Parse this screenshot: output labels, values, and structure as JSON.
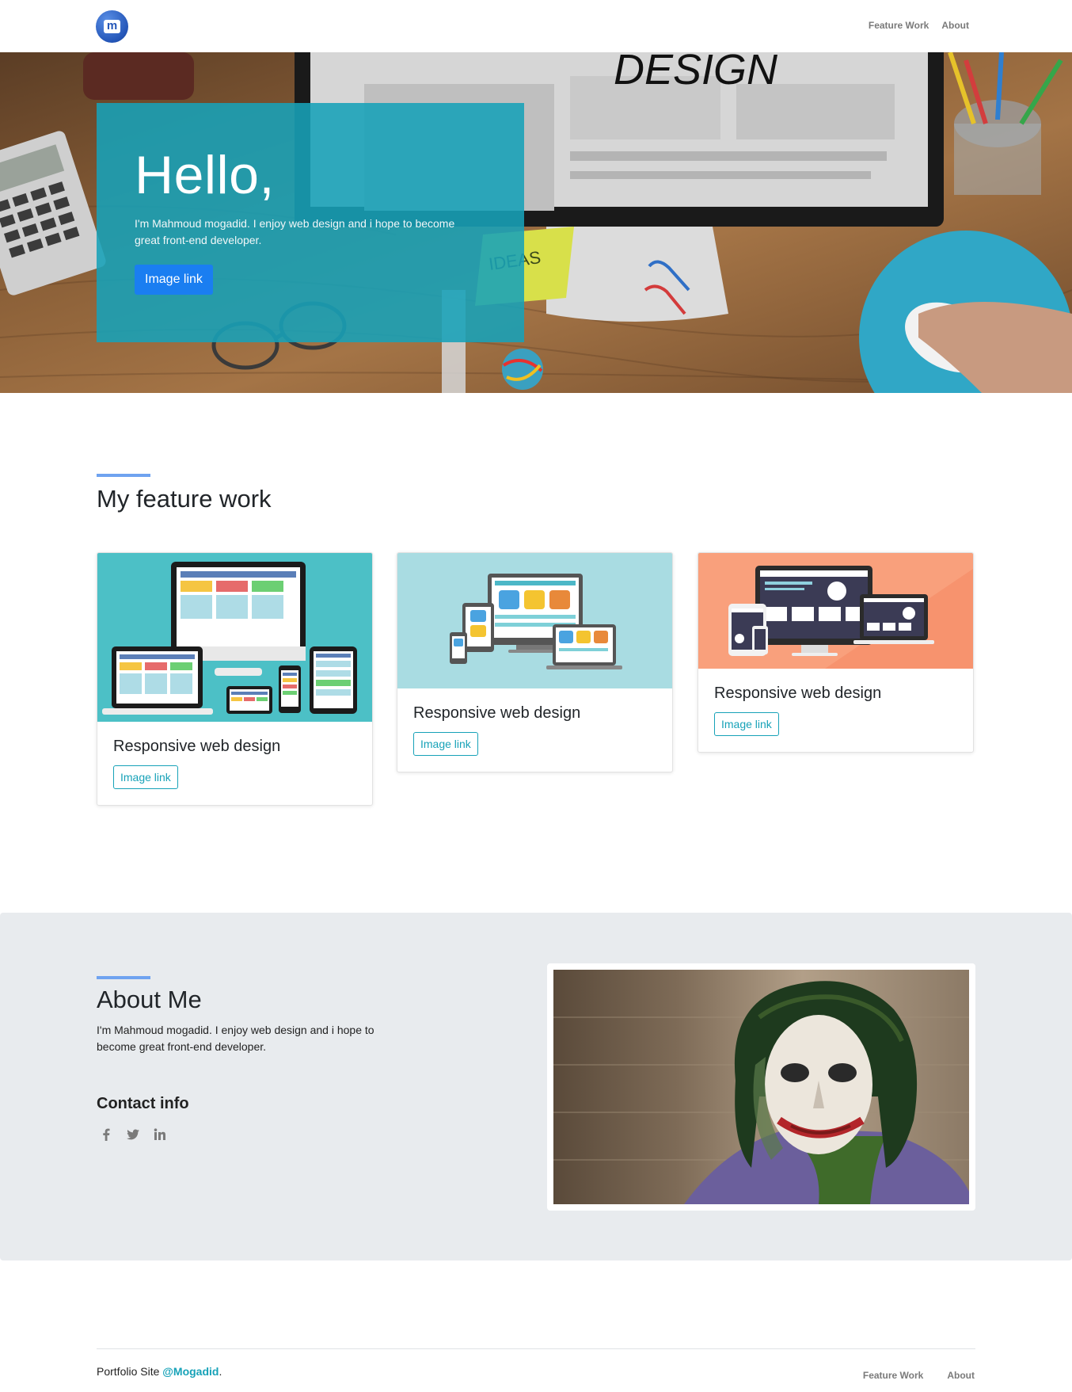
{
  "nav": {
    "logo_letter": "m",
    "links": [
      "Feature Work",
      "About"
    ]
  },
  "hero": {
    "title": "Hello,",
    "text": "I'm Mahmoud mogadid. I enjoy web design and i hope to become great front-end developer.",
    "button": "Image link",
    "background_lettering": "DESIGN",
    "note_lettering": "IDEAS"
  },
  "features": {
    "title": "My feature work",
    "cards": [
      {
        "title": "Responsive web design",
        "button": "Image link",
        "image": "responsive-devices-teal"
      },
      {
        "title": "Responsive web design",
        "button": "Image link",
        "image": "responsive-devices-lightblue"
      },
      {
        "title": "Responsive web design",
        "button": "Image link",
        "image": "responsive-devices-orange"
      }
    ]
  },
  "about": {
    "title": "About Me",
    "text": "I'm Mahmoud mogadid. I enjoy web design and i hope to become great front-end developer.",
    "contact_title": "Contact info",
    "socials": [
      "facebook-icon",
      "twitter-icon",
      "linkedin-icon"
    ],
    "photo": "joker-portrait"
  },
  "footer": {
    "text": "Portfolio Site ",
    "link": "@Mogadid",
    "suffix": ".",
    "links": [
      "Feature Work",
      "About"
    ]
  },
  "colors": {
    "primary": "#1a7ef1",
    "info": "#17a2b8",
    "accent_bar": "#6fa3f0",
    "about_bg": "#e8ebee"
  }
}
